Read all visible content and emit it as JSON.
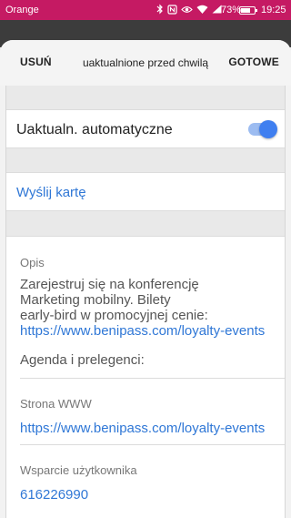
{
  "status_bar": {
    "carrier": "Orange",
    "battery_percent": "73%",
    "battery_level": 0.73,
    "time": "19:25",
    "icons": [
      "bluetooth-icon",
      "nfc-icon",
      "eye-icon",
      "wifi-icon",
      "signal-icon",
      "battery-icon"
    ]
  },
  "toolbar": {
    "delete_label": "USUŃ",
    "title": "uaktualnione przed chwilą",
    "done_label": "GOTOWE"
  },
  "settings": {
    "auto_update_label": "Uaktualn. automatyczne",
    "auto_update_on": true,
    "send_card_label": "Wyślij kartę"
  },
  "details": {
    "description_title": "Opis",
    "description_lines": [
      "Zarejestruj się na konferencję",
      "Marketing mobilny. Bilety",
      "early-bird w promocyjnej cenie:"
    ],
    "description_link": "https://www.benipass.com/loyalty-events",
    "description_extra": "Agenda i prelegenci:",
    "website_title": "Strona WWW",
    "website_link": "https://www.benipass.com/loyalty-events",
    "support_title": "Wsparcie użytkownika",
    "support_phone": "616226990"
  },
  "colors": {
    "status_bar": "#c51a63",
    "accent": "#3f7ff0",
    "link": "#2f77d6"
  }
}
